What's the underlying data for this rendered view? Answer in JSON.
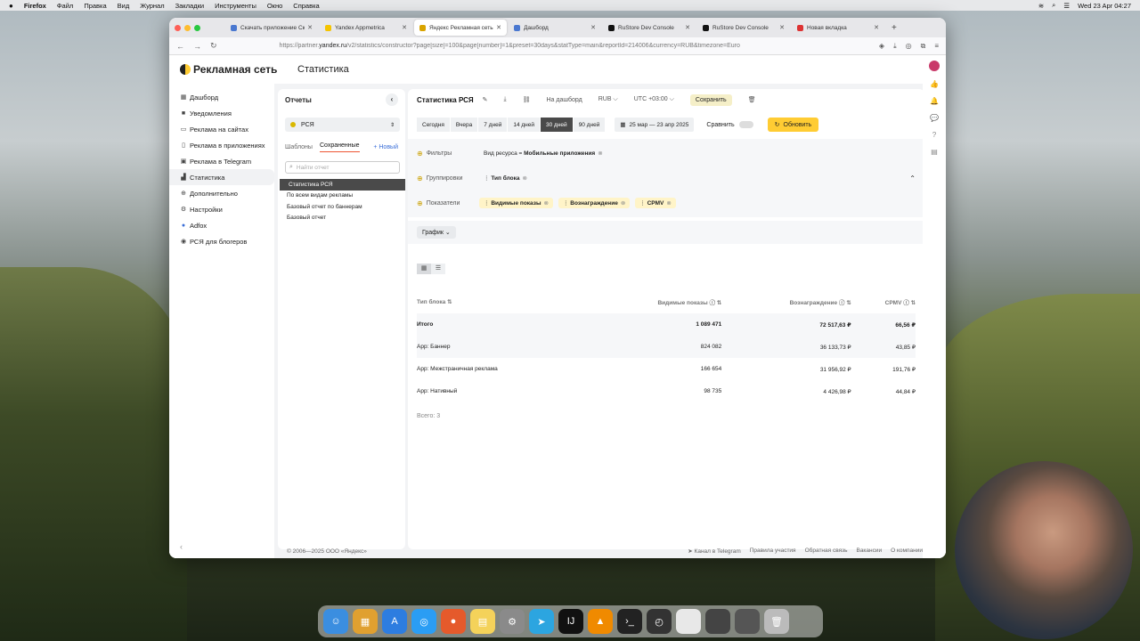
{
  "menubar": {
    "app": "Firefox",
    "items": [
      "Файл",
      "Правка",
      "Вид",
      "Журнал",
      "Закладки",
      "Инструменты",
      "Окно",
      "Справка"
    ],
    "datetime": "Wed 23 Apr 04:27"
  },
  "browser": {
    "tabs": [
      {
        "label": "Скачать приложение Ск"
      },
      {
        "label": "Yandex Appmetrica"
      },
      {
        "label": "Яндекс Рекламная сеть"
      },
      {
        "label": "Дашборд"
      },
      {
        "label": "RuStore Dev Console"
      },
      {
        "label": "RuStore Dev Console"
      },
      {
        "label": "Новая вкладка"
      }
    ],
    "url_prefix": "https://partner.",
    "url_host": "yandex.ru",
    "url_rest": "/v2/statistics/constructor?page[size]=100&page[number]=1&preset=30days&statType=main&reportId=214006&currency=RUB&timezone=Euro"
  },
  "brand": {
    "logo": "Рекламная сеть",
    "page_title": "Статистика"
  },
  "sidebar": {
    "items": [
      {
        "label": "Дашборд",
        "icon": "▦"
      },
      {
        "label": "Уведомления",
        "icon": "■"
      },
      {
        "label": "Реклама на сайтах",
        "icon": "▭"
      },
      {
        "label": "Реклама в приложениях",
        "icon": "▯"
      },
      {
        "label": "Реклама в Telegram",
        "icon": "▣"
      },
      {
        "label": "Статистика",
        "icon": "▟"
      },
      {
        "label": "Дополнительно",
        "icon": "⊕"
      },
      {
        "label": "Настройки",
        "icon": "⚙"
      },
      {
        "label": "Adfox",
        "icon": "●"
      },
      {
        "label": "РСЯ для блогеров",
        "icon": "◉"
      }
    ],
    "collapse": "‹"
  },
  "reports": {
    "title": "Отчеты",
    "back": "‹",
    "select_value": "РСЯ",
    "tab_templates": "Шаблоны",
    "tab_saved": "Сохраненные",
    "new": "+ Новый",
    "search_placeholder": "Найти отчет",
    "list": [
      "Статистика РСЯ",
      "По всем видам рекламы",
      "Базовый отчет по баннерам",
      "Базовый отчет"
    ]
  },
  "toolbar": {
    "report_name": "Статистика РСЯ",
    "to_dashboard": "На дашборд",
    "currency": "RUB ⌵",
    "timezone": "UTC +03:00 ⌵",
    "save": "Сохранить"
  },
  "periods": {
    "buttons": [
      "Сегодня",
      "Вчера",
      "7 дней",
      "14 дней",
      "30 дней",
      "90 дней"
    ],
    "date_range": "25 мар — 23 апр 2025",
    "compare": "Сравнить",
    "refresh": "Обновить"
  },
  "params": {
    "filters_label": "Фильтры",
    "filter_chip_key": "Вид ресурса = ",
    "filter_chip_value": "Мобильные приложения",
    "groups_label": "Группировки",
    "group_chip": "Тип блока",
    "metrics_label": "Показатели",
    "metric_chips": [
      "Видимые показы",
      "Вознаграждение",
      "CPMV"
    ]
  },
  "view": {
    "chart_button": "График"
  },
  "table": {
    "headers": [
      "Тип блока",
      "Видимые показы",
      "Вознаграждение",
      "CPMV"
    ],
    "total": [
      "Итого",
      "1 089 471",
      "72 517,63 ₽",
      "66,56 ₽"
    ],
    "rows": [
      [
        "App: Баннер",
        "824 082",
        "36 133,73 ₽",
        "43,85 ₽"
      ],
      [
        "App: Межстраничная реклама",
        "166 654",
        "31 956,92 ₽",
        "191,76 ₽"
      ],
      [
        "App: Нативный",
        "98 735",
        "4 426,98 ₽",
        "44,84 ₽"
      ]
    ],
    "count": "Всего: 3"
  },
  "footer": {
    "copyright": "© 2006—2025 ООО «Яндекс»",
    "links": [
      "Канал в Telegram",
      "Правила участия",
      "Обратная связь",
      "Вакансии",
      "О компании"
    ]
  }
}
